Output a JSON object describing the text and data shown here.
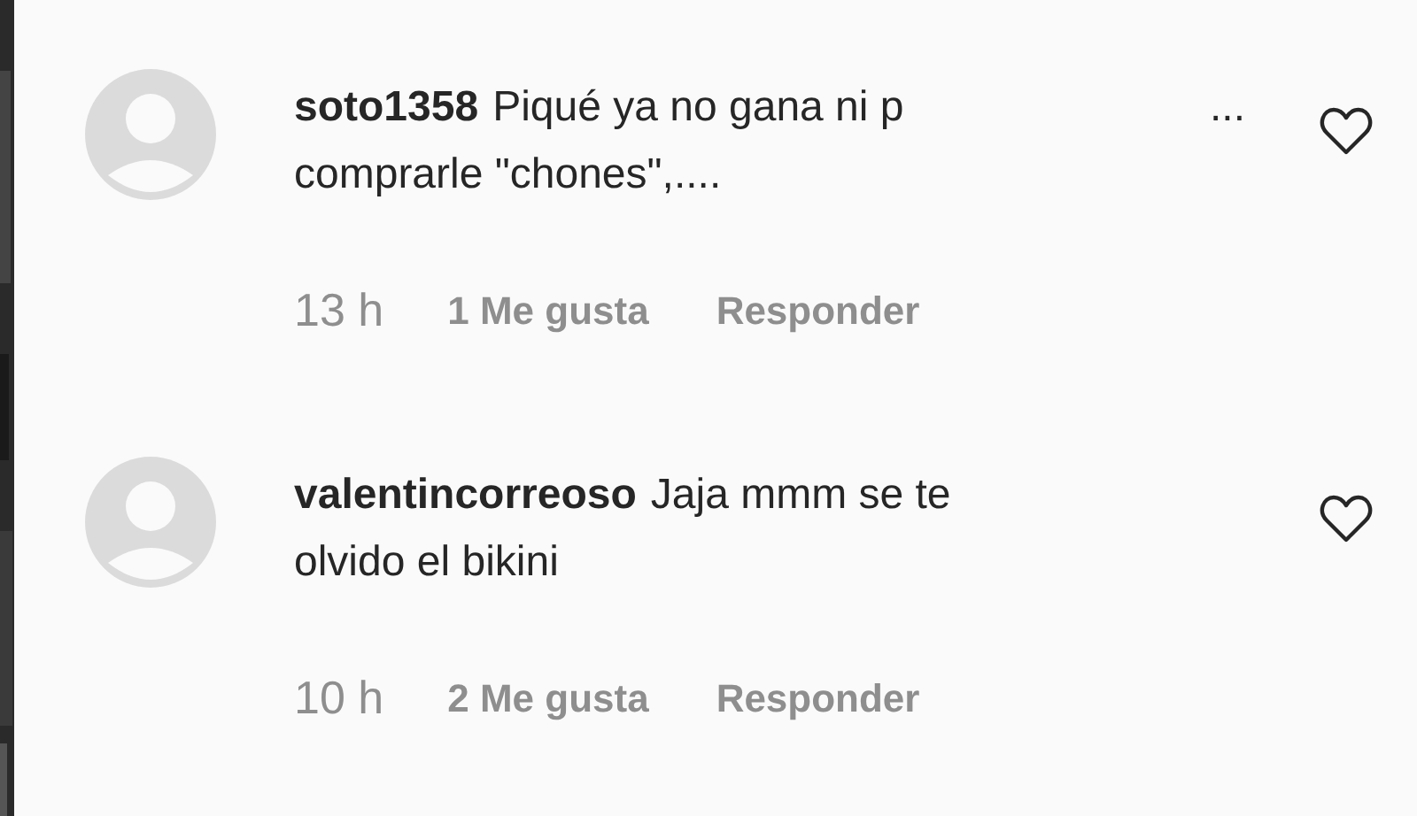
{
  "comments": [
    {
      "username": "soto1358",
      "lines": [
        "Piqué ya no gana ni p",
        "comprarle \"chones\",...."
      ],
      "more": "...",
      "time": "13 h",
      "likes": "1 Me gusta",
      "reply": "Responder"
    },
    {
      "username": "valentincorreoso",
      "lines": [
        "Jaja mmm se te",
        "olvido el bikini"
      ],
      "time": "10 h",
      "likes": "2 Me gusta",
      "reply": "Responder"
    }
  ]
}
